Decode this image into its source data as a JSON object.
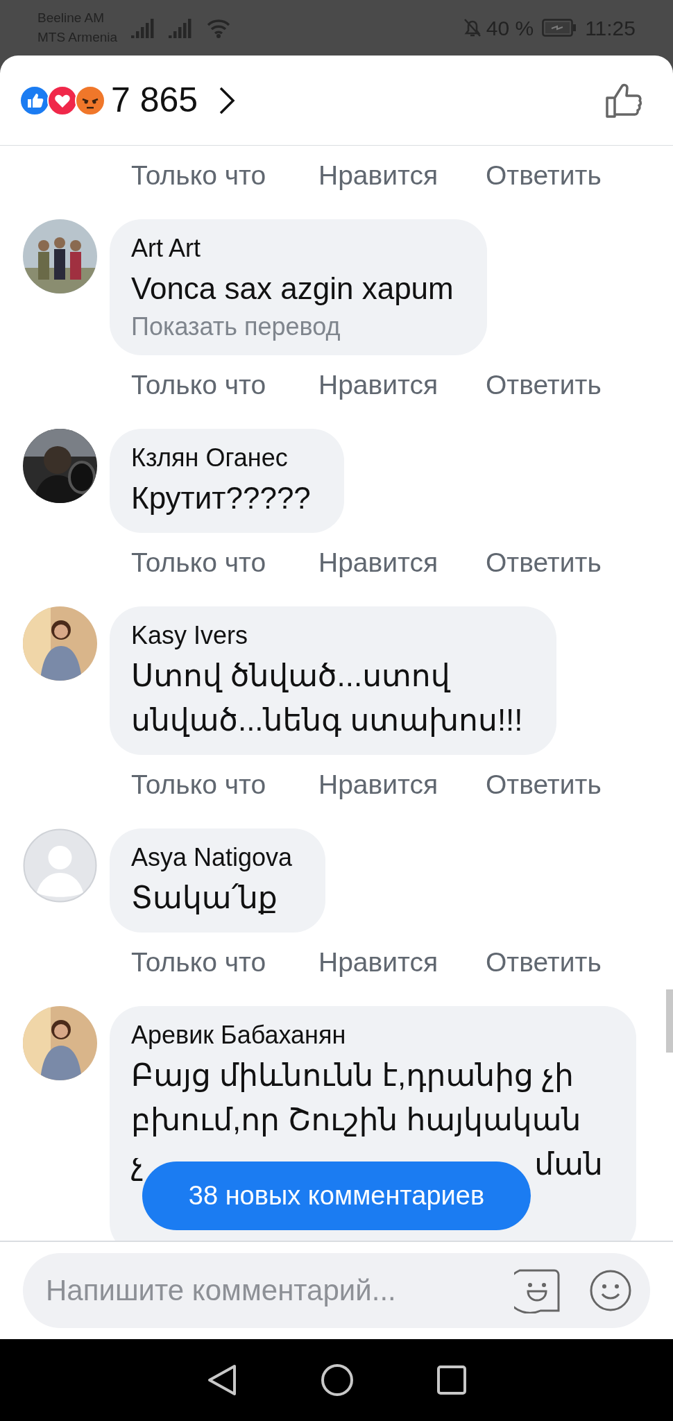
{
  "status_bar": {
    "carriers": [
      "Beeline AM",
      "MTS Armenia"
    ],
    "battery": "40 %",
    "time": "11:25"
  },
  "header": {
    "reactions": [
      {
        "kind": "like"
      },
      {
        "kind": "love"
      },
      {
        "kind": "angry"
      }
    ],
    "count": "7 865"
  },
  "top_actions": {
    "time": "Только что",
    "like": "Нравится",
    "reply": "Ответить"
  },
  "comments": [
    {
      "avatar": {
        "kind": "picture"
      },
      "name": "Art Art",
      "lines": [
        "Vonca sax azgin xapum"
      ],
      "translate": "Показать перевод",
      "time": "Только что",
      "like": "Нравится",
      "reply": "Ответить"
    },
    {
      "avatar": {
        "kind": "picture"
      },
      "name": "Кзлян Оганес",
      "lines": [
        "Крутит?????"
      ],
      "time": "Только что",
      "like": "Нравится",
      "reply": "Ответить"
    },
    {
      "avatar": {
        "kind": "picture"
      },
      "name": "Kasy Ivers",
      "lines": [
        "Ստով ծնված...ստով",
        "սնված...նենգ ստախոս!!!"
      ],
      "time": "Только что",
      "like": "Нравится",
      "reply": "Ответить"
    },
    {
      "avatar": {
        "kind": "default"
      },
      "name": "Asya Natigova",
      "lines": [
        "Տակա՛նք"
      ],
      "time": "Только что",
      "like": "Нравится",
      "reply": "Ответить"
    },
    {
      "avatar": {
        "kind": "picture"
      },
      "name": "Аревик Бабаханян",
      "lines": [
        "Բայց միևնունն է,դրանից չի",
        "բխում,որ Շուշին հայկական"
      ],
      "covered": [
        "չ",
        "ման"
      ]
    }
  ],
  "new_comments_button": "38 новых комментариев",
  "composer": {
    "placeholder": "Напишите комментарий..."
  }
}
